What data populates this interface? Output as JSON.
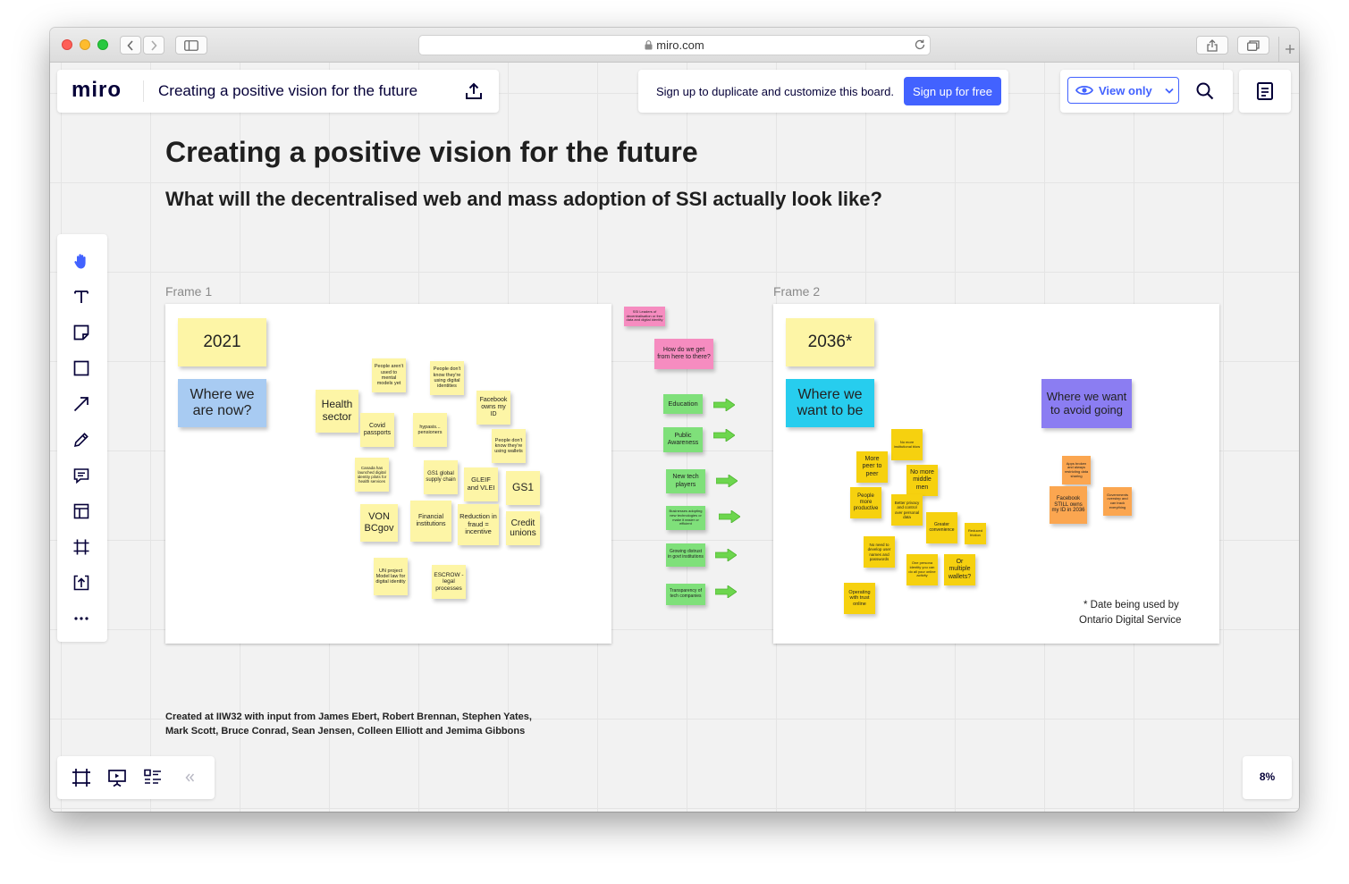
{
  "browser": {
    "url": "miro.com"
  },
  "header": {
    "logo": "miro",
    "board_title": "Creating a positive vision for the future",
    "signup_text": "Sign up to duplicate and customize this board.",
    "signup_button": "Sign up for free",
    "view_mode": "View only"
  },
  "board": {
    "title": "Creating a positive vision for the future",
    "subtitle": "What will the decentralised web and mass adoption of SSI actually look like?",
    "credits_line1": "Created at IIW32 with input from James Ebert, Robert Brennan, Stephen Yates,",
    "credits_line2": "Mark Scott, Bruce Conrad, Sean Jensen, Colleen Elliott and Jemima Gibbons",
    "frame1": {
      "label": "Frame 1",
      "year": "2021",
      "heading": "Where we are now?",
      "notes": [
        "People aren't used to mental models yet",
        "People don't know they're using digital identities",
        "Health sector",
        "Facebook owns my ID",
        "Covid passports",
        "hypasis... pensioners",
        "People don't know they're using wallets",
        "Canada has launched digital identity pilots for health services",
        "GS1 global supply chain",
        "GLEIF and VLEI",
        "GS1",
        "VON BCgov",
        "Financial institutions",
        "Reduction in fraud = incentive",
        "Credit unions",
        "UN project Model law for digital identity",
        "ESCROW - legal processes"
      ]
    },
    "middle": {
      "pink_notes": [
        "SSI Leaders of decentralisation or free data and digital identity",
        "How do we get from here to there?"
      ],
      "green_notes": [
        "Education",
        "Public Awareness",
        "New tech players",
        "Businesses adopting new technologies or make it easier or efficient",
        "Growing distrust in govt institutions",
        "Transparency of tech companies"
      ]
    },
    "frame2": {
      "label": "Frame 2",
      "year": "2036*",
      "heading": "Where we want to be",
      "avoid_heading": "Where we want to avoid going",
      "notes": [
        "No more institutional blow",
        "More peer to peer",
        "No more middle men",
        "People more productive",
        "Better privacy and control over personal data",
        "Greater convenience",
        "Reduced friction",
        "No need to develop user names and passwords",
        "One persona identity you can do all your online activity",
        "Or multiple wallets?",
        "Operating with trust online"
      ],
      "avoid_notes": [
        "Apps broken and always restricting data sharing",
        "Facebook STILL owns my ID in 2036",
        "Governments overstep and can track everything"
      ],
      "footnote_line1": "* Date being used by",
      "footnote_line2": "Ontario Digital Service"
    }
  },
  "zoom": "8%",
  "colors": {
    "brand_button": "#4262ff",
    "sticky_yellow_light": "#fdf5a6",
    "sticky_yellow": "#f6d10f",
    "sticky_blue": "#a8cbf2",
    "sticky_cyan": "#27cdee",
    "sticky_violet": "#8b7df2",
    "sticky_pink": "#f68cc0",
    "sticky_green": "#7fe07a",
    "sticky_orange": "#fba650"
  }
}
